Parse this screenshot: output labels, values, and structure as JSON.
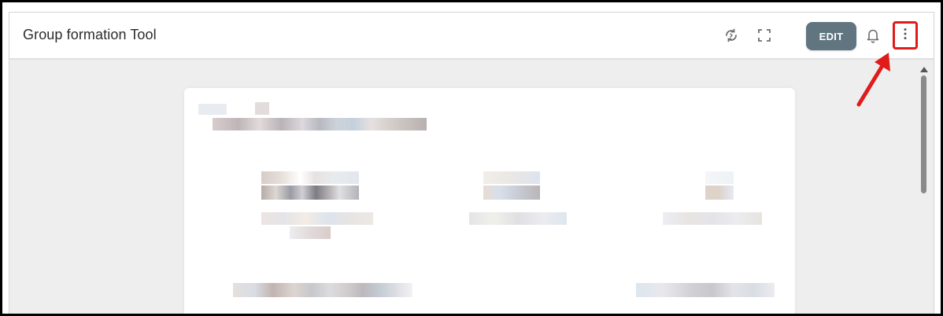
{
  "header": {
    "title": "Group formation Tool",
    "edit_label": "EDIT"
  },
  "icons": {
    "refresh": "refresh-icon",
    "fullscreen": "fullscreen-icon",
    "bell": "bell-icon",
    "more": "more-vertical-icon"
  },
  "colors": {
    "edit_button": "#607580",
    "highlight": "#e01b1b",
    "panel_bg": "#eeeeee"
  }
}
